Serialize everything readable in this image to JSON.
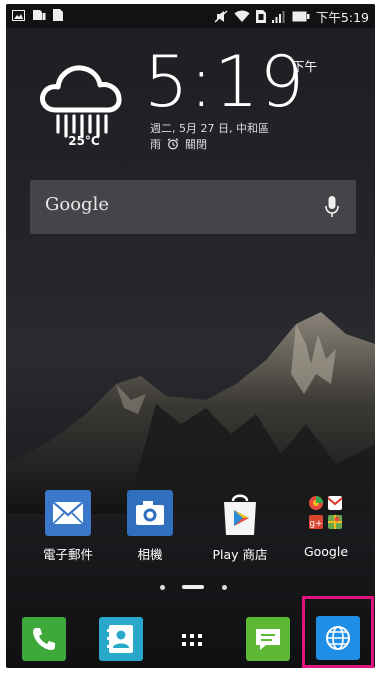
{
  "status_bar": {
    "time": "下午5:19",
    "icons": [
      "image-icon",
      "sd-card-icon",
      "file-icon",
      "mute-icon",
      "wifi-icon",
      "sim-icon",
      "signal-icon",
      "battery-icon"
    ]
  },
  "clock": {
    "time": "5:19",
    "ampm": "下午",
    "date": "週二, 5月 27 日, 中和區",
    "weather_desc": "雨",
    "alarm": "關閉",
    "temperature": "25°C"
  },
  "search": {
    "label": "Google"
  },
  "apps": [
    {
      "label": "電子郵件",
      "icon": "email-icon",
      "color": "#3b78c9"
    },
    {
      "label": "相機",
      "icon": "camera-icon",
      "color": "#2f6fbd"
    },
    {
      "label": "Play 商店",
      "icon": "play-store-icon",
      "color": "#ffffff"
    },
    {
      "label": "Google",
      "icon": "google-folder-icon",
      "color": "#444444"
    }
  ],
  "page_indicator": {
    "pages": 3,
    "current": 2
  },
  "dock": [
    {
      "icon": "phone-icon",
      "color": "#3fa83a"
    },
    {
      "icon": "contacts-icon",
      "color": "#29a9c9"
    },
    {
      "icon": "app-drawer-icon",
      "color": "#ffffff"
    },
    {
      "icon": "messaging-icon",
      "color": "#5cb835"
    },
    {
      "icon": "browser-icon",
      "color": "#1f8ee6"
    }
  ],
  "highlight_color": "#e0147a"
}
